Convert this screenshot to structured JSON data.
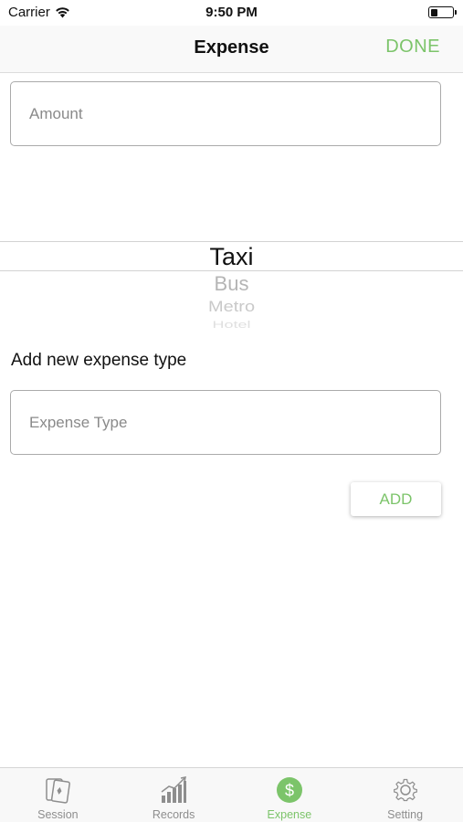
{
  "status_bar": {
    "carrier": "Carrier",
    "time": "9:50 PM",
    "battery_level": 0.3
  },
  "nav": {
    "title": "Expense",
    "done_label": "DONE"
  },
  "amount_field": {
    "placeholder": "Amount",
    "value": ""
  },
  "picker": {
    "selected": "Taxi",
    "items": [
      "Taxi",
      "Bus",
      "Metro",
      "Hotel"
    ]
  },
  "add_section": {
    "label": "Add new expense type",
    "type_placeholder": "Expense Type",
    "type_value": "",
    "add_label": "ADD"
  },
  "tabs": [
    {
      "label": "Session",
      "icon": "cards-icon"
    },
    {
      "label": "Records",
      "icon": "bar-chart-icon"
    },
    {
      "label": "Expense",
      "icon": "dollar-circle-icon",
      "active": true
    },
    {
      "label": "Setting",
      "icon": "gear-icon"
    }
  ],
  "colors": {
    "accent": "#7cc46a",
    "inactive": "#8e8e8e"
  }
}
